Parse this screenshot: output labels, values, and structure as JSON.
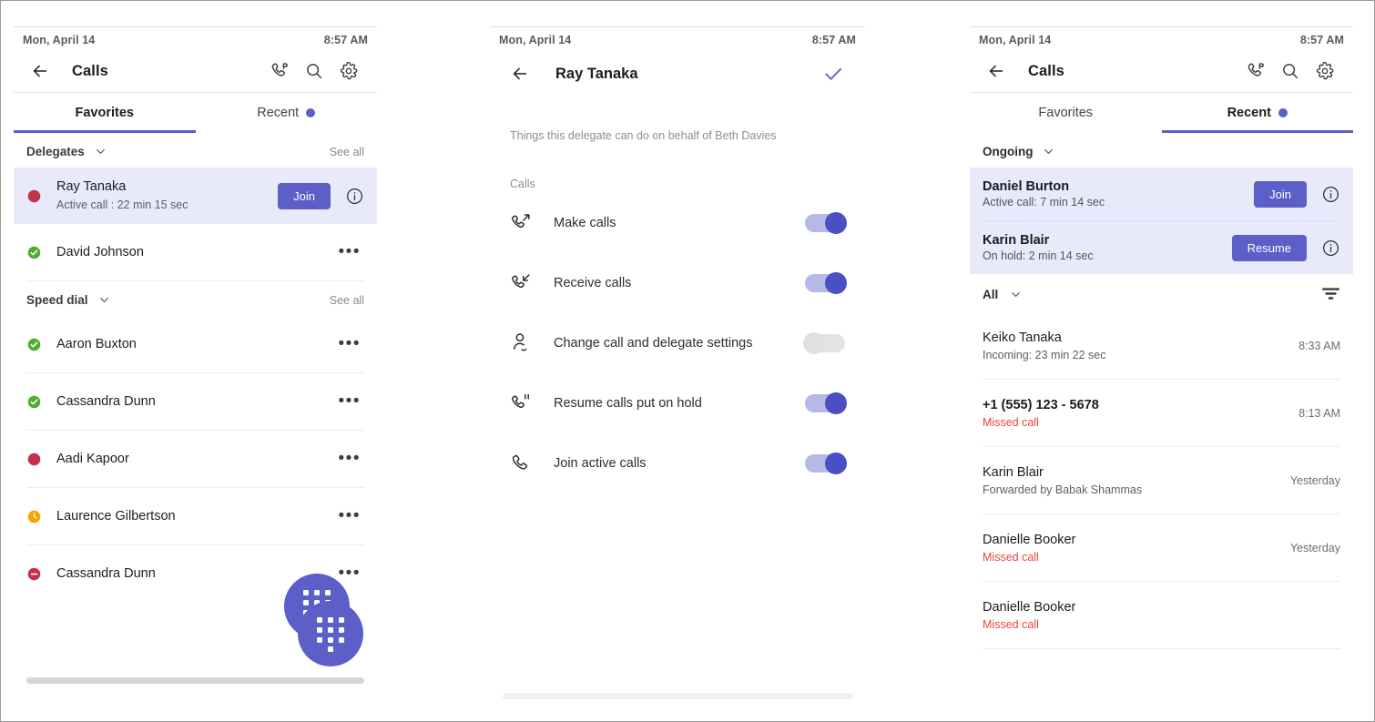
{
  "colors": {
    "accent": "#5b5fc7",
    "accent_dark": "#4b4fc4",
    "highlight_bg": "#e8e9fb",
    "missed_red": "#e8453c",
    "available_green": "#4caf2e",
    "busy_red": "#c4314b",
    "away_orange": "#f8a200"
  },
  "panel1": {
    "status": {
      "date": "Mon, April 14",
      "time": "8:57 AM"
    },
    "appbar": {
      "title": "Calls",
      "back_icon": "back-arrow-icon",
      "icons": [
        "call-park-icon",
        "search-icon",
        "settings-gear-icon"
      ]
    },
    "tabs": [
      {
        "label": "Favorites",
        "active": true,
        "dot": false
      },
      {
        "label": "Recent",
        "active": false,
        "dot": true
      }
    ],
    "sections": [
      {
        "title": "Delegates",
        "see_all": "See all",
        "items": [
          {
            "name": "Ray Tanaka",
            "sub": "Active call : 22 min 15 sec",
            "presence": "busy",
            "highlight": true,
            "action": "Join",
            "info": true
          }
        ]
      },
      {
        "title": "Speed dial",
        "see_all": "See all",
        "items": [
          {
            "name": "Aaron Buxton",
            "presence": "available",
            "more": "•••"
          },
          {
            "name": "Cassandra Dunn",
            "presence": "available",
            "more": "•••"
          },
          {
            "name": "Aadi Kapoor",
            "presence": "busy",
            "more": "•••"
          },
          {
            "name": "Laurence Gilbertson",
            "presence": "away",
            "more": "•••"
          },
          {
            "name": "Cassandra Dunn",
            "presence": "dnd",
            "more": "•••"
          }
        ]
      }
    ],
    "delegate_extra": {
      "name": "David Johnson",
      "presence": "available",
      "more": "•••"
    },
    "fab": "dialpad-icon"
  },
  "panel2": {
    "status": {
      "date": "Mon, April 14",
      "time": "8:57 AM"
    },
    "appbar": {
      "title": "Ray Tanaka",
      "back_icon": "back-arrow-icon",
      "confirm_icon": "checkmark-icon"
    },
    "description": "Things this delegate can do on behalf of Beth Davies",
    "group_label": "Calls",
    "permissions": [
      {
        "label": "Make calls",
        "icon": "phone-outgoing-icon",
        "on": true
      },
      {
        "label": "Receive calls",
        "icon": "phone-incoming-icon",
        "on": true
      },
      {
        "label": "Change call and delegate settings",
        "icon": "person-settings-icon",
        "on": false
      },
      {
        "label": "Resume calls put on hold",
        "icon": "phone-hold-icon",
        "on": true
      },
      {
        "label": "Join active calls",
        "icon": "phone-icon",
        "on": true
      }
    ]
  },
  "panel3": {
    "status": {
      "date": "Mon, April 14",
      "time": "8:57 AM"
    },
    "appbar": {
      "title": "Calls",
      "back_icon": "back-arrow-icon",
      "icons": [
        "call-park-icon",
        "search-icon",
        "settings-gear-icon"
      ]
    },
    "tabs": [
      {
        "label": "Favorites",
        "active": false,
        "dot": false
      },
      {
        "label": "Recent",
        "active": true,
        "dot": true
      }
    ],
    "ongoing": {
      "title": "Ongoing",
      "items": [
        {
          "name": "Daniel Burton",
          "sub": "Active call: 7 min 14 sec",
          "action": "Join"
        },
        {
          "name": "Karin Blair",
          "sub": "On hold: 2 min 14 sec",
          "action": "Resume"
        }
      ]
    },
    "filter": {
      "label": "All",
      "icon": "filter-icon"
    },
    "calls": [
      {
        "name": "Keiko Tanaka",
        "sub": "Incoming: 23 min 22 sec",
        "missed": false,
        "time": "8:33 AM"
      },
      {
        "name": "+1 (555) 123 - 5678",
        "sub": "Missed call",
        "missed": true,
        "time": "8:13 AM"
      },
      {
        "name": "Karin Blair",
        "sub": "Forwarded by Babak Shammas",
        "missed": false,
        "time": "Yesterday"
      },
      {
        "name": "Danielle Booker",
        "sub": "Missed call",
        "missed": true,
        "time": "Yesterday"
      },
      {
        "name": "Danielle Booker",
        "sub": "Missed call",
        "missed": true,
        "time": ""
      }
    ],
    "fab": "dialpad-icon"
  }
}
